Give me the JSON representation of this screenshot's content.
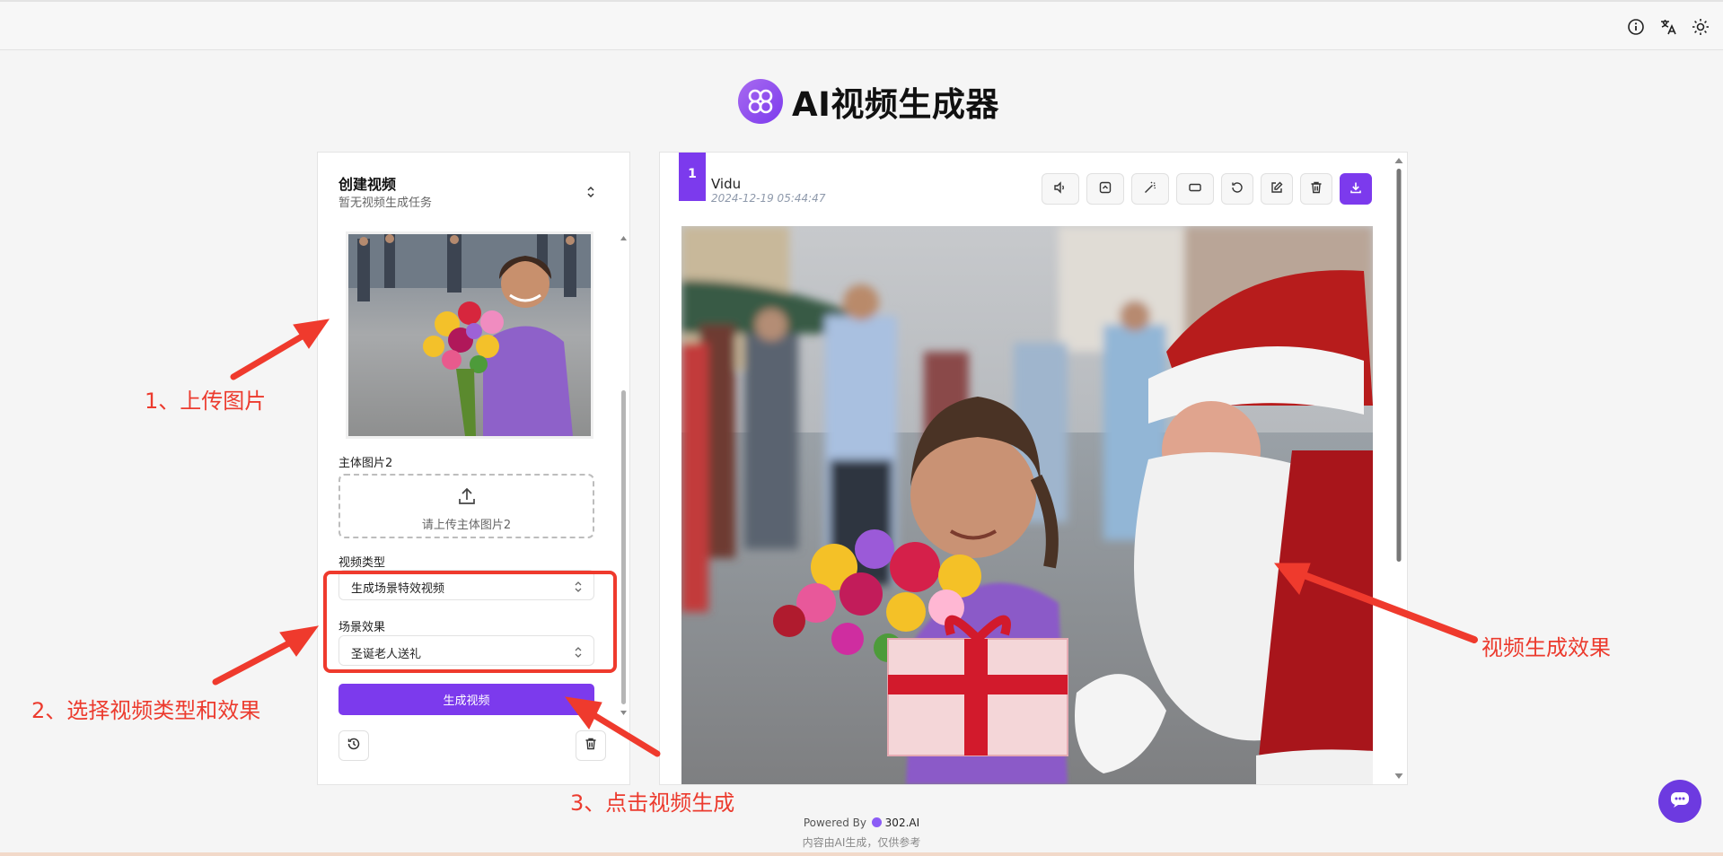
{
  "app": {
    "title": "AI视频生成器"
  },
  "topbar": {
    "icons": [
      "info-icon",
      "translate-icon",
      "sun-icon"
    ]
  },
  "left_panel": {
    "title": "创建视频",
    "subtitle": "暂无视频生成任务",
    "main_image_2_label": "主体图片2",
    "upload_placeholder": "请上传主体图片2",
    "video_type_label": "视频类型",
    "video_type_value": "生成场景特效视频",
    "scene_effect_label": "场景效果",
    "scene_effect_value": "圣诞老人送礼",
    "generate_button": "生成视频"
  },
  "task": {
    "index": "1",
    "model": "Vidu",
    "timestamp": "2024-12-19 05:44:47",
    "toolbar_icons": [
      "volume-icon",
      "expand-icon",
      "magic-wand-icon",
      "aspect-ratio-icon",
      "refresh-icon",
      "edit-icon",
      "trash-icon",
      "download-icon"
    ]
  },
  "annotations": {
    "step1": "1、上传图片",
    "step2": "2、选择视频类型和效果",
    "step3": "3、点击视频生成",
    "result": "视频生成效果",
    "color": "#ec3b2e"
  },
  "footer": {
    "powered_by": "Powered By",
    "brand": "302.AI",
    "disclaimer": "内容由AI生成，仅供参考"
  },
  "colors": {
    "accent": "#7c3aed",
    "annotation": "#ec3b2e"
  }
}
